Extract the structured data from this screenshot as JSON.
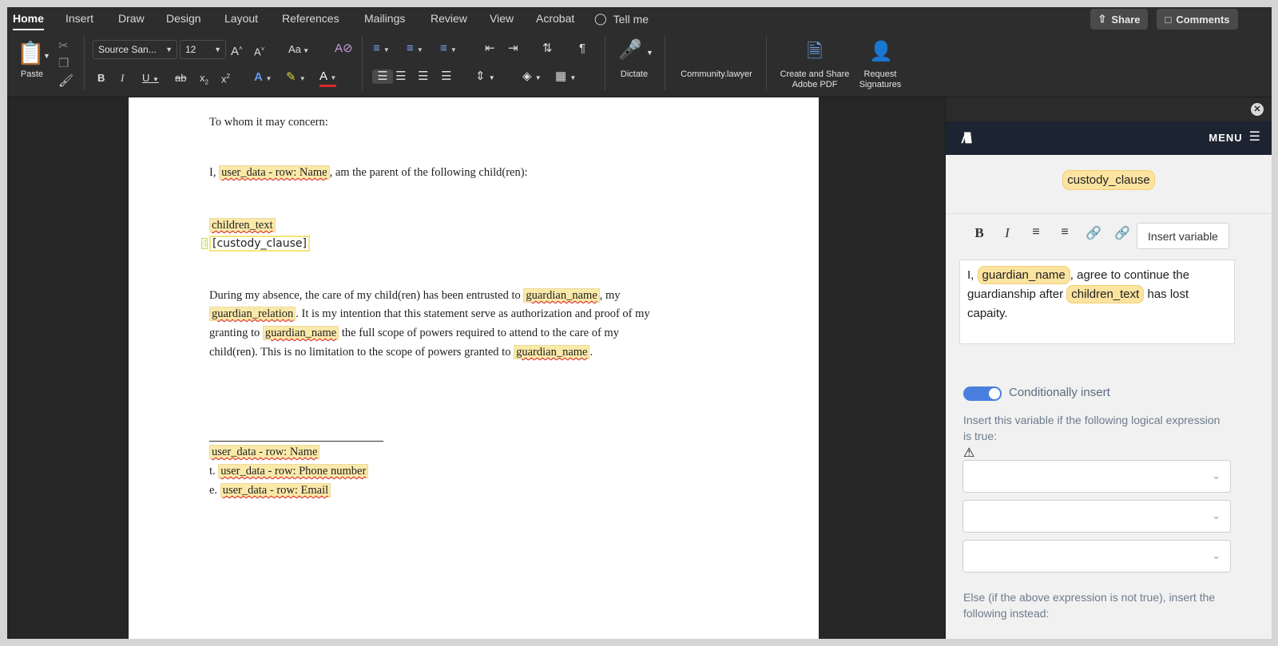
{
  "ribbon": {
    "tabs": [
      {
        "label": "Home",
        "active": true
      },
      {
        "label": "Insert"
      },
      {
        "label": "Draw"
      },
      {
        "label": "Design"
      },
      {
        "label": "Layout"
      },
      {
        "label": "References"
      },
      {
        "label": "Mailings"
      },
      {
        "label": "Review"
      },
      {
        "label": "View"
      },
      {
        "label": "Acrobat"
      }
    ],
    "tell_me": "Tell me",
    "share": "Share",
    "comments": "Comments",
    "paste": "Paste",
    "font_name": "Source San...",
    "font_size": "12",
    "dictate": "Dictate",
    "community": "Community.lawyer",
    "create_share_1": "Create and Share",
    "create_share_2": "Adobe PDF",
    "request_1": "Request",
    "request_2": "Signatures"
  },
  "document": {
    "greeting": "To whom it may concern:",
    "line1_pre": "I,",
    "line1_var": "user_data - row: Name",
    "line1_post": ", am the parent of the following child(ren):",
    "children_var": "children_text",
    "custody_clause": "[custody_clause]",
    "p_pre1": "During my absence, the care of my child(ren) has been entrusted to",
    "p_var_guardian": "guardian_name",
    "p_post1": ", my",
    "p_var_relation": "guardian_relation",
    "p_post2": ". It is my intention that this statement serve as authorization and proof of my",
    "p_pre3": "granting to",
    "p_post3": "the full scope of powers required to attend to the care of my",
    "p_pre4": "child(ren). This is no limitation to the scope of powers granted to",
    "p_post4": ".",
    "sig_name": "user_data - row: Name",
    "sig_t": "t.",
    "sig_phone": "user_data - row: Phone number",
    "sig_e": "e.",
    "sig_email": "user_data - row: Email"
  },
  "panel": {
    "menu": "MENU",
    "variable_title": "custody_clause",
    "insert_variable": "Insert variable",
    "editor_pre": "I,",
    "editor_var1": "guardian_name",
    "editor_mid": ", agree to continue the guardianship after",
    "editor_var2": "children_text",
    "editor_post": "has lost capaity.",
    "toggle_on": true,
    "toggle_label": "Conditionally insert",
    "condition_help": "Insert this variable if the following logical expression is true:",
    "else_text": "Else (if the above expression is not true), insert the following instead:"
  },
  "colors": {
    "variable_highlight": "#fbe9a9",
    "toggle_blue": "#4a7fe0",
    "panel_header": "#1d2431"
  }
}
